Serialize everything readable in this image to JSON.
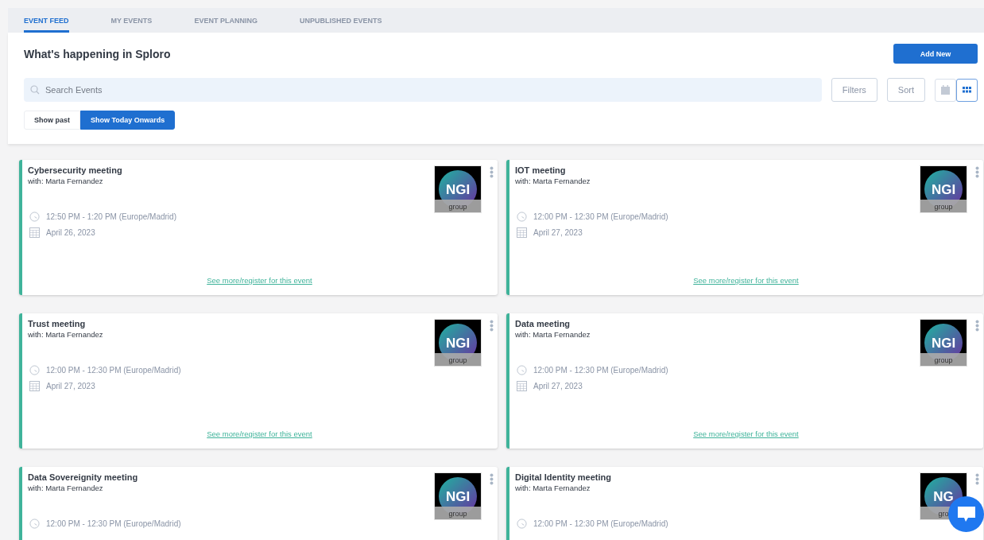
{
  "tabs": [
    {
      "label": "EVENT FEED",
      "selected": true
    },
    {
      "label": "MY EVENTS",
      "selected": false
    },
    {
      "label": "EVENT PLANNING",
      "selected": false
    },
    {
      "label": "UNPUBLISHED EVENTS",
      "selected": false
    }
  ],
  "heading": "What's happening in Sploro",
  "add_button": "Add New",
  "search": {
    "placeholder": "Search Events"
  },
  "filters_button": "Filters",
  "sort_button": "Sort",
  "view_toggle": [
    {
      "kind": "calendar",
      "selected": false
    },
    {
      "kind": "grid",
      "selected": true
    }
  ],
  "range_toggle": [
    {
      "label": "Show past",
      "selected": false
    },
    {
      "label": "Show Today Onwards",
      "selected": true
    }
  ],
  "events": [
    {
      "title": "Cybersecurity meeting",
      "host": "with: Marta Fernandez",
      "time": "12:50 PM - 1:20 PM (Europe/Madrid)",
      "date": "April 26, 2023",
      "link": "See more/register for this event",
      "logo": "NGI",
      "logo_caption": "group"
    },
    {
      "title": "IOT meeting",
      "host": "with: Marta Fernandez",
      "time": "12:00 PM - 12:30 PM (Europe/Madrid)",
      "date": "April 27, 2023",
      "link": "See more/register for this event",
      "logo": "NGI",
      "logo_caption": "group"
    },
    {
      "title": "Trust meeting",
      "host": "with: Marta Fernandez",
      "time": "12:00 PM - 12:30 PM (Europe/Madrid)",
      "date": "April 27, 2023",
      "link": "See more/register for this event",
      "logo": "NGI",
      "logo_caption": "group"
    },
    {
      "title": "Data meeting",
      "host": "with: Marta Fernandez",
      "time": "12:00 PM - 12:30 PM (Europe/Madrid)",
      "date": "April 27, 2023",
      "link": "See more/register for this event",
      "logo": "NGI",
      "logo_caption": "group"
    },
    {
      "title": "Data Sovereignity meeting",
      "host": "with: Marta Fernandez",
      "time": "12:00 PM - 12:30 PM (Europe/Madrid)",
      "logo": "NGI",
      "logo_caption": "group"
    },
    {
      "title": "Digital Identity meeting",
      "host": "with: Marta Fernandez",
      "time": "12:00 PM - 12:30 PM (Europe/Madrid)",
      "logo": "NG",
      "logo_caption": "gro"
    }
  ]
}
